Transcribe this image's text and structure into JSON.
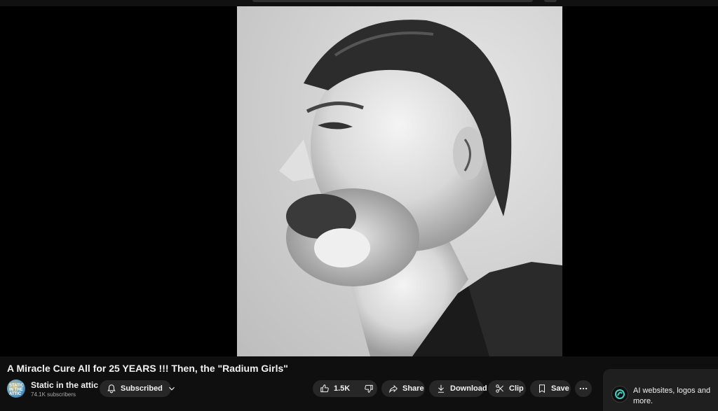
{
  "video": {
    "title": "A Miracle Cure All for 25 YEARS !!! Then, the \"Radium Girls\""
  },
  "channel": {
    "name": "Static in the attic",
    "subscribers": "74.1K subscribers",
    "avatar_text": "STATIC IN THE ATTIC"
  },
  "actions": {
    "subscribe_label": "Subscribed",
    "like_count": "1.5K",
    "share_label": "Share",
    "download_label": "Download",
    "clip_label": "Clip",
    "save_label": "Save"
  },
  "promo": {
    "text": "AI websites, logos and more."
  },
  "icons": {
    "bell": "bell-icon",
    "chevron": "chevron-down-icon",
    "like": "thumbs-up-icon",
    "dislike": "thumbs-down-icon",
    "share": "share-arrow-icon",
    "download": "download-icon",
    "clip": "scissors-icon",
    "save": "bookmark-icon",
    "more": "more-horizontal-icon"
  },
  "colors": {
    "background": "#0f0f0f",
    "button": "#272727",
    "text": "#f1f1f1",
    "muted": "#aaaaaa"
  }
}
